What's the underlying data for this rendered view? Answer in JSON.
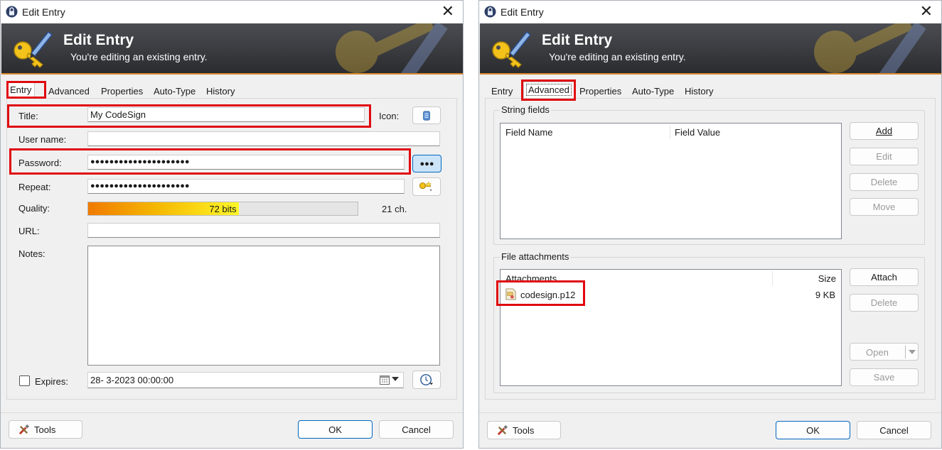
{
  "window_title": "Edit Entry",
  "close_glyph": "✕",
  "banner": {
    "title": "Edit Entry",
    "subtitle": "You're editing an existing entry."
  },
  "tabs": [
    "Entry",
    "Advanced",
    "Properties",
    "Auto-Type",
    "History"
  ],
  "entry_tab": {
    "title_label": "Title:",
    "title_value": "My CodeSign",
    "icon_label": "Icon:",
    "username_label": "User name:",
    "username_value": "",
    "password_label": "Password:",
    "password_value": "●●●●●●●●●●●●●●●●●●●●●",
    "reveal_button": "●●●",
    "repeat_label": "Repeat:",
    "repeat_value": "●●●●●●●●●●●●●●●●●●●●●",
    "quality_label": "Quality:",
    "quality_text": "72 bits",
    "quality_fraction": 0.56,
    "quality_chars": "21 ch.",
    "url_label": "URL:",
    "url_value": "",
    "notes_label": "Notes:",
    "notes_value": "",
    "expires_label": "Expires:",
    "expires_checked": false,
    "expires_value": "28-  3-2023 00:00:00"
  },
  "advanced_tab": {
    "string_fields_group": "String fields",
    "field_name_header": "Field Name",
    "field_value_header": "Field Value",
    "add_button": "Add",
    "edit_button": "Edit",
    "delete_button": "Delete",
    "move_button": "Move",
    "attachments_group": "File attachments",
    "attachments_header": "Attachments",
    "size_header": "Size",
    "attachments": [
      {
        "name": "codesign.p12",
        "size": "9 KB"
      }
    ],
    "attach_button": "Attach",
    "delete_attachment_button": "Delete",
    "open_button": "Open",
    "save_button": "Save"
  },
  "footer": {
    "tools_button": "Tools",
    "ok_button": "OK",
    "cancel_button": "Cancel"
  },
  "colors": {
    "highlight": "#e0090f",
    "banner_accent": "#d8892e",
    "primary_button_border": "#0067c0"
  }
}
